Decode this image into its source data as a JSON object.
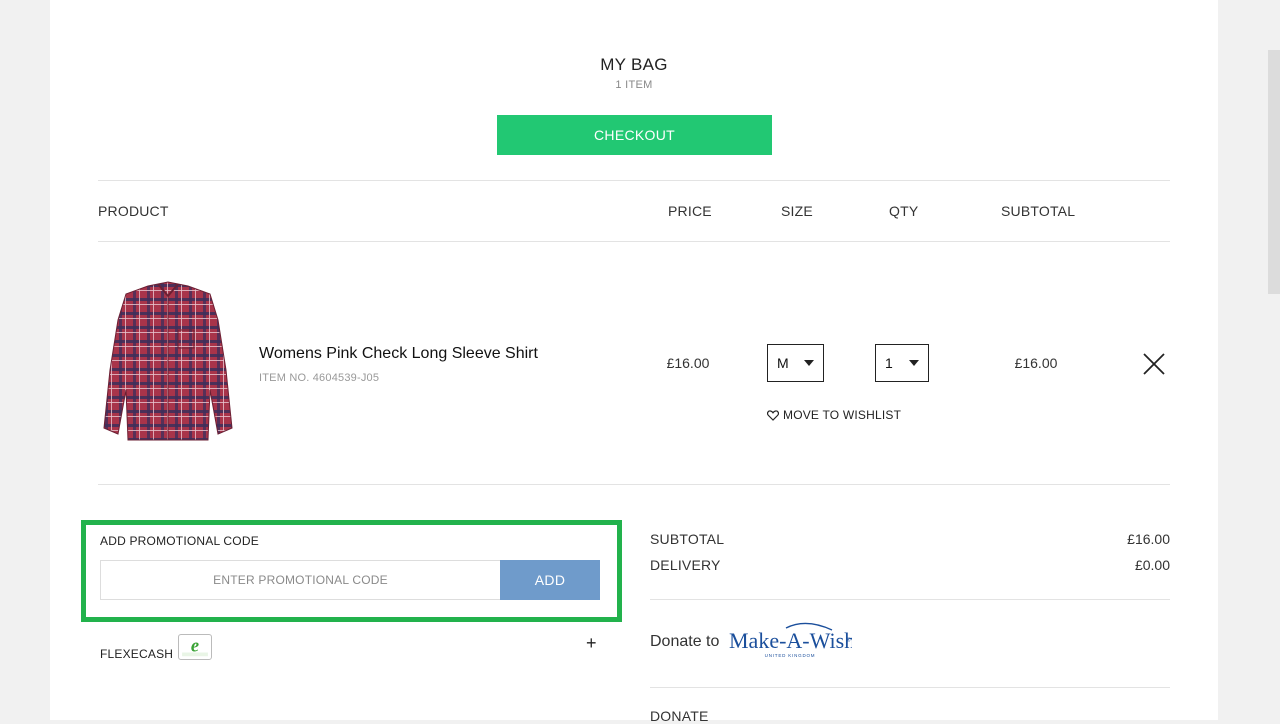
{
  "bag": {
    "title": "MY BAG",
    "count": "1 ITEM",
    "checkout_label": "CHECKOUT"
  },
  "columns": {
    "product": "PRODUCT",
    "price": "PRICE",
    "size": "SIZE",
    "qty": "QTY",
    "subtotal": "SUBTOTAL"
  },
  "item": {
    "name": "Womens Pink Check Long Sleeve Shirt",
    "item_no": "ITEM NO. 4604539-J05",
    "price": "£16.00",
    "size": "M",
    "qty": "1",
    "subtotal": "£16.00",
    "wishlist_label": "MOVE TO WISHLIST",
    "image_icon": "plaid-shirt-image"
  },
  "promo": {
    "label": "ADD PROMOTIONAL CODE",
    "placeholder": "ENTER PROMOTIONAL CODE",
    "value": "",
    "add_label": "ADD",
    "highlight_color": "#22b24c"
  },
  "flexecash": {
    "label": "FLEXECASH",
    "expand_symbol": "+",
    "logo_text": "flexecash"
  },
  "summary": {
    "subtotal_label": "SUBTOTAL",
    "subtotal_value": "£16.00",
    "delivery_label": "DELIVERY",
    "delivery_value": "£0.00"
  },
  "donate": {
    "donate_to": "Donate to",
    "charity_logo_text": "Make-A-Wish",
    "charity_logo_sub": "UNITED KINGDOM",
    "donate_heading": "DONATE"
  },
  "colors": {
    "checkout": "#22c873",
    "add_button": "#6f9bcb",
    "highlight": "#22b24c",
    "charity_blue": "#1b4f9c"
  }
}
